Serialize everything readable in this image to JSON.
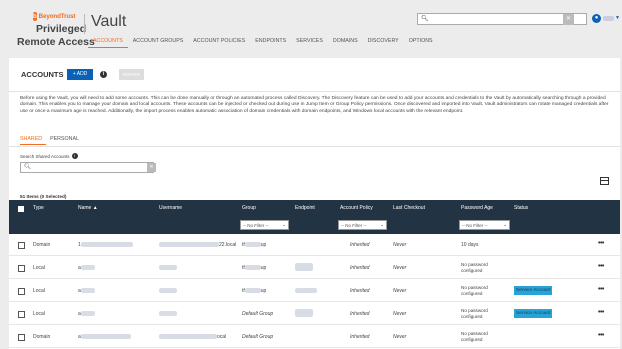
{
  "brand": {
    "logo_text": "BeyondTrust",
    "line1": "Privileged",
    "line2": "Remote Access"
  },
  "app_title": "Vault",
  "header_search": {
    "placeholder": "",
    "clear_glyph": "✕"
  },
  "user": {
    "avatar_glyph": "●"
  },
  "nav_tabs": [
    "ACCOUNTS",
    "ACCOUNT GROUPS",
    "ACCOUNT POLICIES",
    "ENDPOINTS",
    "SERVICES",
    "DOMAINS",
    "DISCOVERY",
    "OPTIONS"
  ],
  "accounts": {
    "title": "ACCOUNTS",
    "add_label": "+ ADD",
    "info_glyph": "i",
    "rotate_label": "ROTATE",
    "intro": "Before using the Vault, you will need to add some accounts. This can be done manually or through an automated process called Discovery. The Discovery feature can be used to add your accounts and credentials to the Vault by automatically searching through a provided domain. This enables you to manage your domain and local accounts. These accounts can be injected or checked out during use in Jump Item or Group Policy permissions. Once discovered and imported into Vault, Vault administrators can rotate managed credentials after use or once a maximum age is reached. Additionally, the import process enables automatic association of domain credentials with domain endpoints, and Windows local accounts with the relevant endpoint."
  },
  "subtabs": [
    "SHARED",
    "PERSONAL"
  ],
  "shared_search": {
    "label": "Search Shared Accounts",
    "placeholder": ""
  },
  "table": {
    "items_count": "51 Items (0 Selected)",
    "headers": {
      "type": "Type",
      "name": "Name ▲",
      "username": "Username",
      "group": "Group",
      "endpoint": "Endpoint",
      "policy": "Account Policy",
      "last_checkout": "Last Checkout",
      "password_age": "Password Age",
      "status": "Status"
    },
    "filter_placeholder": "-- No Filter --",
    "rows": [
      {
        "type": "Domain",
        "name_prefix": "1",
        "username_suffix": "22.local",
        "group_prefix": "tf",
        "group_suffix": "up",
        "policy": "Inherited",
        "last_checkout": "Never",
        "password_age": "10 days",
        "password_age_2": "",
        "status": ""
      },
      {
        "type": "Local",
        "name_prefix": "a",
        "username_suffix": "",
        "group_prefix": "tf",
        "group_suffix": "up",
        "policy": "Inherited",
        "last_checkout": "Never",
        "password_age": "No password",
        "password_age_2": "configured",
        "status": ""
      },
      {
        "type": "Local",
        "name_prefix": "a",
        "username_suffix": "",
        "group_prefix": "tf",
        "group_suffix": "up",
        "policy": "Inherited",
        "last_checkout": "Never",
        "password_age": "No password",
        "password_age_2": "configured",
        "status": "Service Account"
      },
      {
        "type": "Local",
        "name_prefix": "a",
        "username_suffix": "",
        "group_prefix": "",
        "group_suffix": "Default Group",
        "policy": "Inherited",
        "last_checkout": "Never",
        "password_age": "No password",
        "password_age_2": "configured",
        "status": "Service Account"
      },
      {
        "type": "Domain",
        "name_prefix": "a",
        "username_suffix": "ocal",
        "group_prefix": "",
        "group_suffix": "Default Group",
        "policy": "Inherited",
        "last_checkout": "Never",
        "password_age": "No password",
        "password_age_2": "configured",
        "status": ""
      }
    ],
    "more_glyph": "•••"
  },
  "colors": {
    "accent": "#f26c21",
    "primary_button": "#0a62b8",
    "table_header": "#223344",
    "status_badge": "#26a3d8"
  }
}
